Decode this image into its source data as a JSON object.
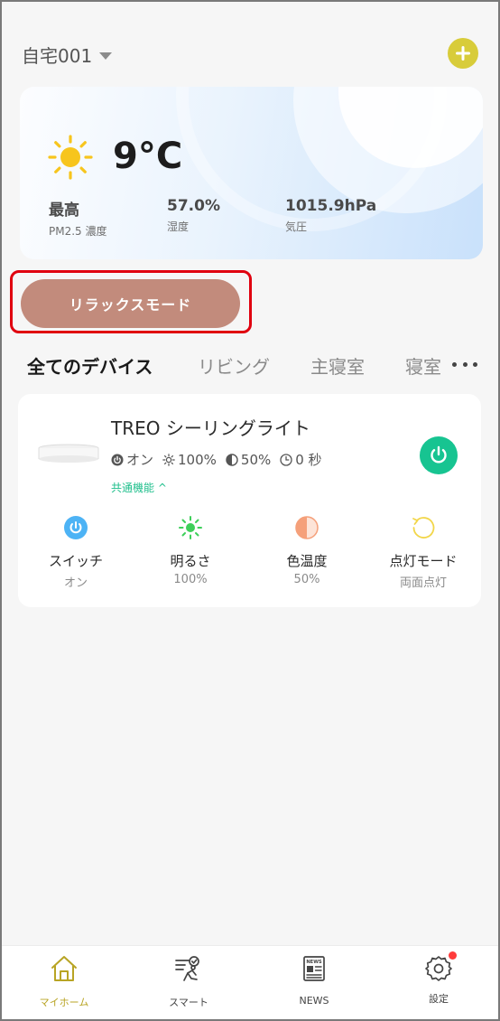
{
  "header": {
    "home_name": "自宅001"
  },
  "weather": {
    "temperature": "9°C",
    "stats": [
      {
        "value": "最高",
        "label": "PM2.5 濃度"
      },
      {
        "value": "57.0%",
        "label": "湿度"
      },
      {
        "value": "1015.9hPa",
        "label": "気圧"
      }
    ]
  },
  "scene": {
    "label": "リラックスモード"
  },
  "tabs": [
    "全てのデバイス",
    "リビング",
    "主寝室",
    "寝室"
  ],
  "device": {
    "name": "TREO シーリングライト",
    "status": [
      {
        "icon": "power-small-icon",
        "text": "オン"
      },
      {
        "icon": "brightness-small-icon",
        "text": "100%"
      },
      {
        "icon": "color-temp-small-icon",
        "text": "50%"
      },
      {
        "icon": "timer-small-icon",
        "text": "0 秒"
      }
    ],
    "common_functions": "共通機能 ^",
    "controls": [
      {
        "name": "スイッチ",
        "value": "オン",
        "icon": "switch-icon",
        "color": "#4db3f5"
      },
      {
        "name": "明るさ",
        "value": "100%",
        "icon": "brightness-icon",
        "color": "#3ecf5a"
      },
      {
        "name": "色温度",
        "value": "50%",
        "icon": "color-temperature-icon",
        "color": "#f5a07a"
      },
      {
        "name": "点灯モード",
        "value": "両面点灯",
        "icon": "light-mode-icon",
        "color": "#f2d64a"
      }
    ]
  },
  "nav": [
    {
      "label": "マイホーム",
      "icon": "home-icon",
      "active": true
    },
    {
      "label": "スマート",
      "icon": "smart-icon",
      "active": false
    },
    {
      "label": "NEWS",
      "icon": "news-icon",
      "active": false
    },
    {
      "label": "設定",
      "icon": "settings-icon",
      "active": false
    }
  ],
  "colors": {
    "accent": "#d8cc3a",
    "scene_button": "#c28b7c",
    "highlight": "#e0000f",
    "power_on": "#17c491",
    "nav_active": "#b8a424"
  }
}
